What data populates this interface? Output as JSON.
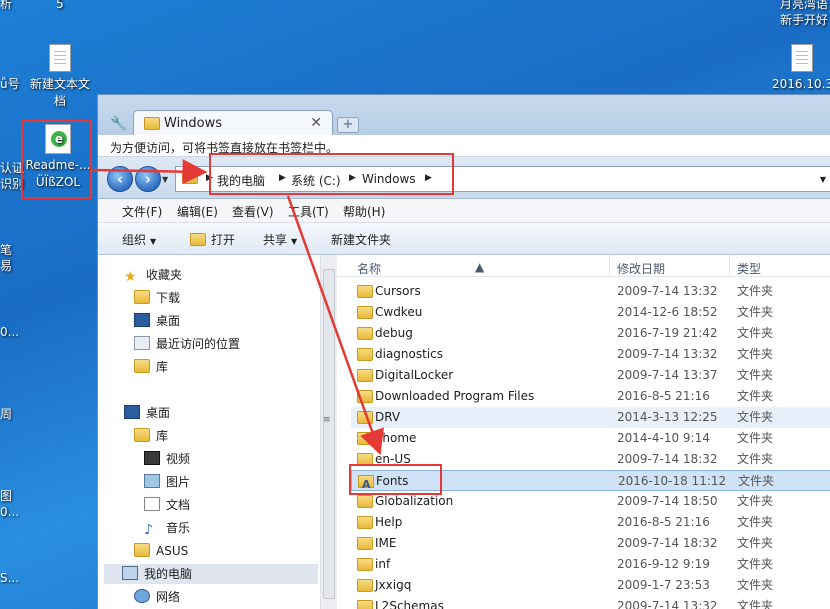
{
  "desktop": {
    "left_fragments": [
      "析",
      "ǚ号",
      "认证",
      "识别",
      "笔",
      "易",
      "0...",
      "周",
      "图",
      "0...",
      "S..."
    ],
    "top_number": "5",
    "top_right_text": [
      "月亮湾语",
      "新手开好"
    ],
    "icons": [
      {
        "label": "新建文本文档"
      },
      {
        "label": "Readme-... ÜÏßZOL"
      },
      {
        "label": "2016.10.3"
      }
    ]
  },
  "window": {
    "tab_title": "Windows",
    "bookmark_hint": "为方便访问，可将书签直接放在书签栏中。",
    "address": [
      "我的电脑",
      "系统 (C:)",
      "Windows"
    ],
    "menu": [
      "文件(F)",
      "编辑(E)",
      "查看(V)",
      "工具(T)",
      "帮助(H)"
    ],
    "toolbar": {
      "organize": "组织",
      "open": "打开",
      "share": "共享",
      "new_folder": "新建文件夹"
    },
    "nav_pane": [
      {
        "label": "收藏夹",
        "icon": "star-icon"
      },
      {
        "label": "下载",
        "icon": "download-folder-icon"
      },
      {
        "label": "桌面",
        "icon": "desktop-icon"
      },
      {
        "label": "最近访问的位置",
        "icon": "recent-places-icon"
      },
      {
        "label": "库",
        "icon": "library-icon"
      },
      {
        "label": "桌面",
        "icon": "desktop-icon"
      },
      {
        "label": "库",
        "icon": "library-icon"
      },
      {
        "label": "视频",
        "icon": "video-icon"
      },
      {
        "label": "图片",
        "icon": "picture-icon"
      },
      {
        "label": "文档",
        "icon": "document-icon"
      },
      {
        "label": "音乐",
        "icon": "music-icon"
      },
      {
        "label": "ASUS",
        "icon": "user-folder-icon"
      },
      {
        "label": "我的电脑",
        "icon": "computer-icon"
      },
      {
        "label": "网络",
        "icon": "network-icon"
      }
    ],
    "columns": {
      "name": "名称",
      "date": "修改日期",
      "type": "类型"
    },
    "files": [
      {
        "name": "Cursors",
        "date": "2009-7-14 13:32",
        "type": "文件夹"
      },
      {
        "name": "Cwdkeu",
        "date": "2014-12-6 18:52",
        "type": "文件夹"
      },
      {
        "name": "debug",
        "date": "2016-7-19 21:42",
        "type": "文件夹"
      },
      {
        "name": "diagnostics",
        "date": "2009-7-14 13:32",
        "type": "文件夹"
      },
      {
        "name": "DigitalLocker",
        "date": "2009-7-14 13:37",
        "type": "文件夹"
      },
      {
        "name": "Downloaded Program Files",
        "date": "2016-8-5 21:16",
        "type": "文件夹"
      },
      {
        "name": "DRV",
        "date": "2014-3-13 12:25",
        "type": "文件夹"
      },
      {
        "name": "ehome",
        "date": "2014-4-10 9:14",
        "type": "文件夹"
      },
      {
        "name": "en-US",
        "date": "2009-7-14 18:32",
        "type": "文件夹"
      },
      {
        "name": "Fonts",
        "date": "2016-10-18 11:12",
        "type": "文件夹"
      },
      {
        "name": "Globalization",
        "date": "2009-7-14 18:50",
        "type": "文件夹"
      },
      {
        "name": "Help",
        "date": "2016-8-5 21:16",
        "type": "文件夹"
      },
      {
        "name": "IME",
        "date": "2009-7-14 18:32",
        "type": "文件夹"
      },
      {
        "name": "inf",
        "date": "2016-9-12 9:19",
        "type": "文件夹"
      },
      {
        "name": "Jxxigq",
        "date": "2009-1-7 23:53",
        "type": "文件夹"
      },
      {
        "name": "L2Schemas",
        "date": "2009-7-14 13:32",
        "type": "文件夹"
      }
    ]
  },
  "colors": {
    "annotation_red": "#e53935",
    "selection": "#d0e2f6"
  }
}
